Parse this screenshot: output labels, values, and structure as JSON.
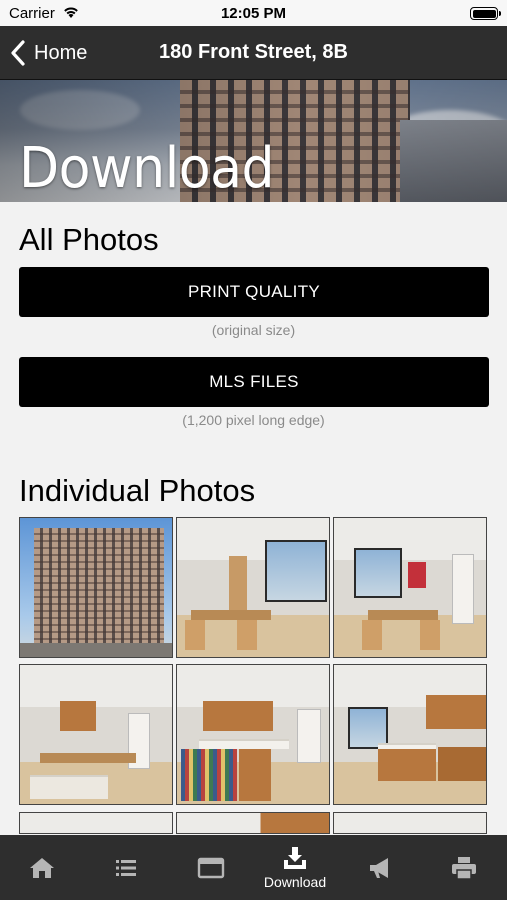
{
  "status": {
    "carrier": "Carrier",
    "time": "12:05 PM"
  },
  "nav": {
    "back_label": "Home",
    "title": "180 Front Street, 8B"
  },
  "hero": {
    "title": "Download"
  },
  "all_photos": {
    "title": "All Photos",
    "print_button": "PRINT QUALITY",
    "print_caption": "(original size)",
    "mls_button": "MLS FILES",
    "mls_caption": "(1,200 pixel long edge)"
  },
  "individual_photos": {
    "title": "Individual Photos"
  },
  "tabs": [
    {
      "icon": "home-icon",
      "label": ""
    },
    {
      "icon": "list-icon",
      "label": ""
    },
    {
      "icon": "browser-window-icon",
      "label": ""
    },
    {
      "icon": "download-icon",
      "label": "Download"
    },
    {
      "icon": "megaphone-icon",
      "label": ""
    },
    {
      "icon": "printer-icon",
      "label": ""
    }
  ],
  "colors": {
    "nav_bg": "#2e2e2e",
    "button_bg": "#000000",
    "page_bg": "#f2f2f2",
    "caption": "#8a8a8a"
  }
}
